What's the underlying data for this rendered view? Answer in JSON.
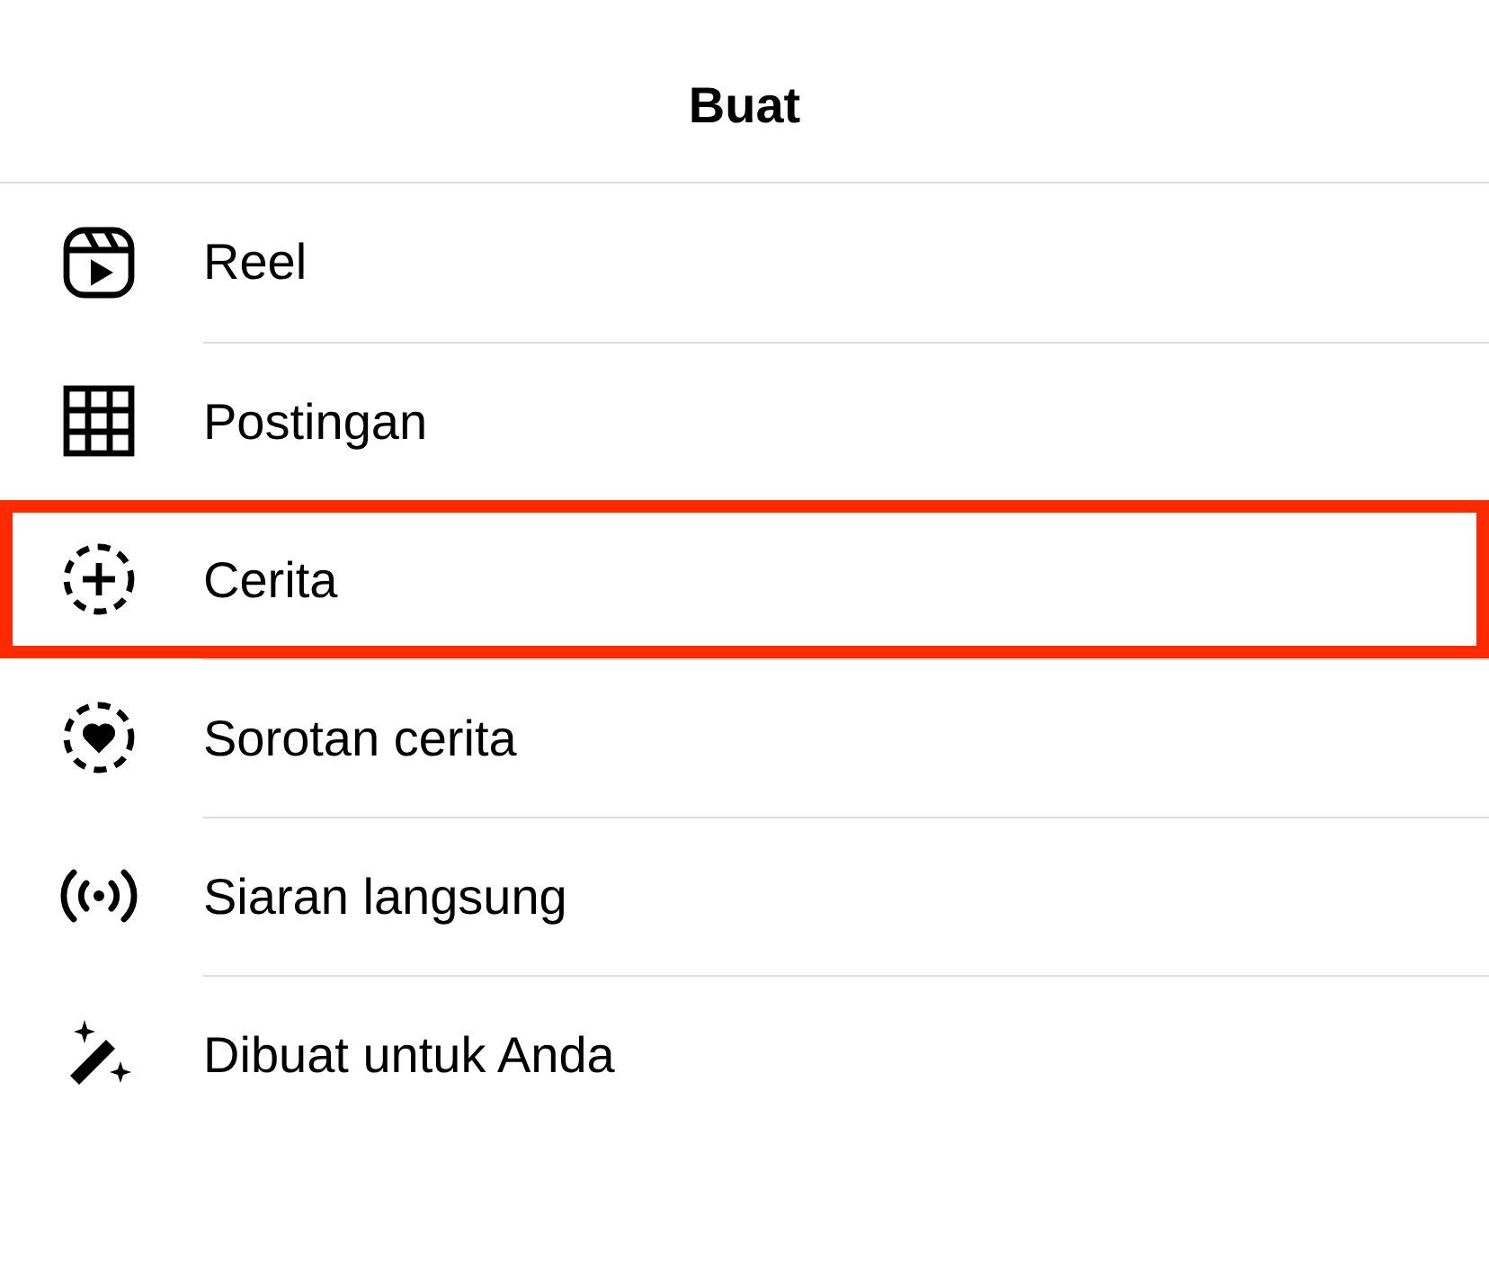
{
  "header": {
    "title": "Buat"
  },
  "items": [
    {
      "kind": "reel",
      "label": "Reel",
      "highlighted": false
    },
    {
      "kind": "post",
      "label": "Postingan",
      "highlighted": false
    },
    {
      "kind": "story",
      "label": "Cerita",
      "highlighted": true
    },
    {
      "kind": "highlight",
      "label": "Sorotan cerita",
      "highlighted": false
    },
    {
      "kind": "live",
      "label": "Siaran langsung",
      "highlighted": false
    },
    {
      "kind": "made",
      "label": "Dibuat untuk Anda",
      "highlighted": false
    }
  ]
}
